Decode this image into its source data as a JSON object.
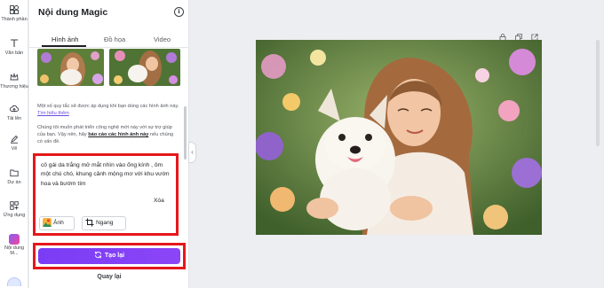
{
  "rail": {
    "items": [
      {
        "label": "Thành phần",
        "icon": "shapes-icon"
      },
      {
        "label": "Văn bản",
        "icon": "text-icon"
      },
      {
        "label": "Thương hiệu",
        "icon": "crown-icon"
      },
      {
        "label": "Tải lên",
        "icon": "upload-icon"
      },
      {
        "label": "Vẽ",
        "icon": "pen-icon"
      },
      {
        "label": "Dự án",
        "icon": "folder-icon"
      },
      {
        "label": "Ứng dụng",
        "icon": "apps-icon"
      },
      {
        "label": "Nội dung M...",
        "icon": "magic-icon"
      }
    ]
  },
  "panel": {
    "title": "Nội dung Magic",
    "info": "i",
    "tabs": [
      "Hình ảnh",
      "Đồ họa",
      "Video"
    ],
    "policy_text": "Một số quy tắc sẽ được áp dụng khi bạn dùng các hình ảnh này.",
    "policy_link": "Tìm hiểu thêm",
    "feedback_text_1": "Chúng tôi muốn phát triển công nghệ mới này với sự trợ giúp của bạn. Vậy nên, hãy",
    "feedback_link": "báo cáo các hình ảnh này",
    "feedback_text_2": "nếu chúng có vấn đề.",
    "prompt": "cô gái da trắng mở mắt nhìn vào ống kính , ôm một chú chó, khung cảnh mộng mơ với khu vườn hoa và bướm tím",
    "clear_label": "Xóa",
    "image_chip": "Ảnh",
    "ratio_chip": "Ngang",
    "regenerate_label": "Tạo lại",
    "back_label": "Quay lại"
  },
  "colors": {
    "accent": "#7a3cf5",
    "highlight": "#e5171b"
  }
}
